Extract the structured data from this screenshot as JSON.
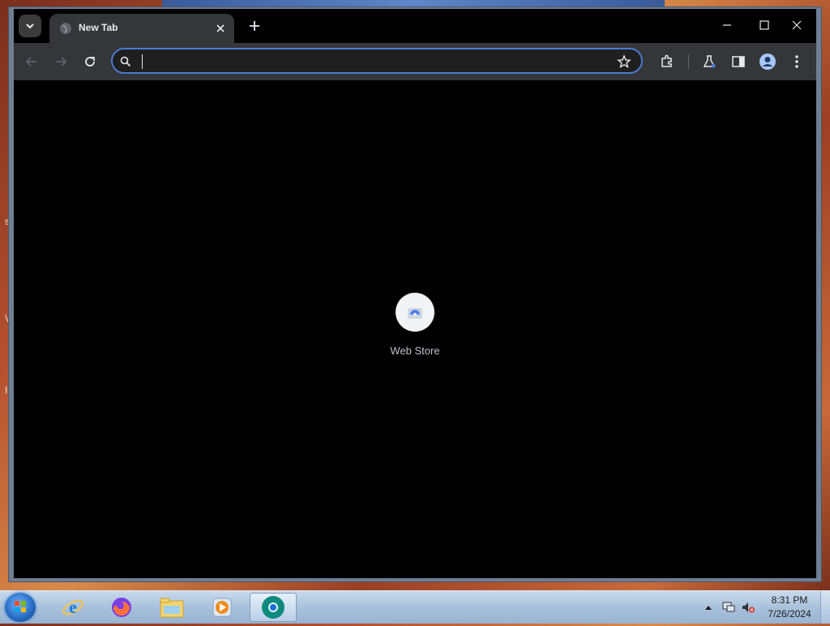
{
  "browser": {
    "tab": {
      "title": "New Tab",
      "favicon": "globe-icon"
    },
    "toolbar": {
      "address_value": "",
      "icons": [
        "back-arrow-icon",
        "forward-arrow-icon",
        "reload-icon",
        "search-icon",
        "star-icon",
        "extensions-icon",
        "labs-flask-icon",
        "side-panel-icon",
        "profile-icon",
        "more-menu-icon"
      ]
    },
    "window_controls": [
      "minimize-icon",
      "maximize-icon",
      "close-icon"
    ],
    "new_tab_page": {
      "shortcuts": [
        {
          "label": "Web Store",
          "icon": "web-store-icon"
        }
      ]
    },
    "accent": "#4a7bd0"
  },
  "taskbar": {
    "apps": [
      "internet-explorer-icon",
      "firefox-icon",
      "file-explorer-icon",
      "media-player-icon",
      "chrome-canary-icon"
    ],
    "clock": {
      "time": "8:31 PM",
      "date": "7/26/2024"
    }
  }
}
